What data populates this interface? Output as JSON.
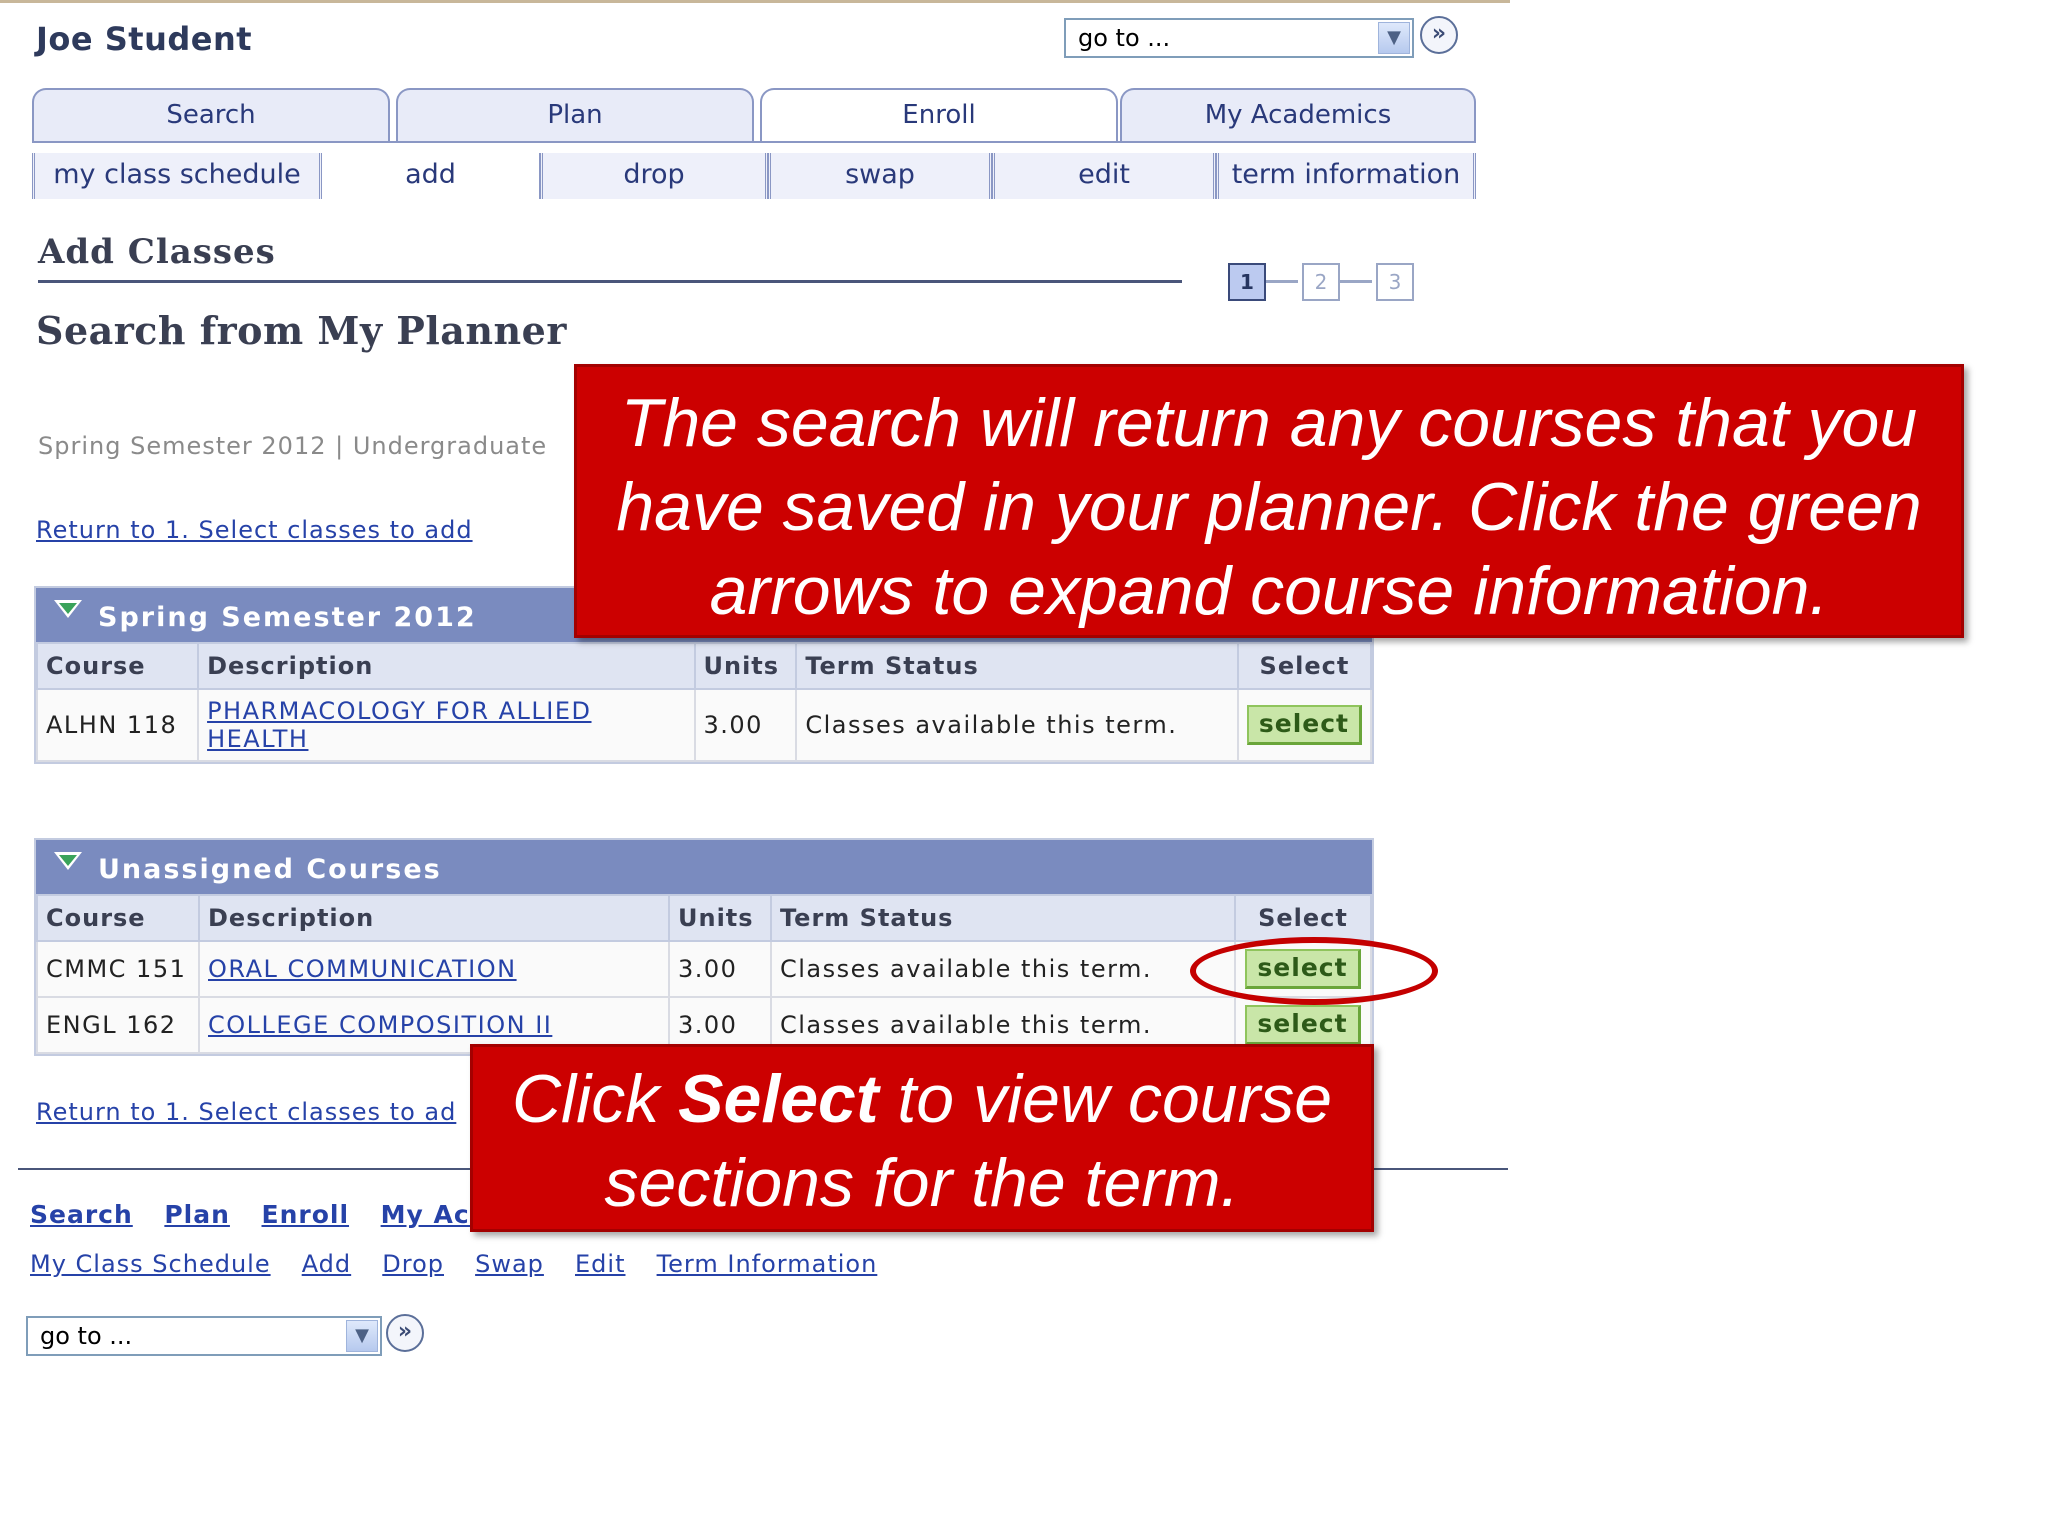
{
  "user": {
    "name": "Joe Student"
  },
  "goto": {
    "label": "go to ..."
  },
  "tabs": [
    {
      "label": "Search"
    },
    {
      "label": "Plan"
    },
    {
      "label": "Enroll"
    },
    {
      "label": "My Academics"
    }
  ],
  "subtabs": [
    {
      "label": "my class schedule"
    },
    {
      "label": "add"
    },
    {
      "label": "drop"
    },
    {
      "label": "swap"
    },
    {
      "label": "edit"
    },
    {
      "label": "term information"
    }
  ],
  "page": {
    "title": "Add Classes",
    "subtitle": "Search from My Planner",
    "term_line": "Spring Semester 2012 | Undergraduate",
    "return_link": "Return to 1. Select classes to add",
    "return_link_short": "Return to 1. Select classes to ad",
    "steps": [
      "1",
      "2",
      "3"
    ]
  },
  "grid_spring": {
    "title": "Spring Semester 2012",
    "headers": [
      "Course",
      "Description",
      "Units",
      "Term Status",
      "Select"
    ],
    "rows": [
      {
        "course": "ALHN 118",
        "description": "PHARMACOLOGY FOR ALLIED HEALTH",
        "units": "3.00",
        "status": "Classes available this term.",
        "select": "select"
      }
    ]
  },
  "grid_unassigned": {
    "title": "Unassigned Courses",
    "headers": [
      "Course",
      "Description",
      "Units",
      "Term Status",
      "Select"
    ],
    "rows": [
      {
        "course": "CMMC 151",
        "description": "ORAL COMMUNICATION",
        "units": "3.00",
        "status": "Classes available this term.",
        "select": "select"
      },
      {
        "course": "ENGL 162",
        "description": "COLLEGE COMPOSITION II",
        "units": "3.00",
        "status": "Classes available this term.",
        "select": "select"
      }
    ]
  },
  "callouts": {
    "top": "The search will return any courses that you have saved in your planner. Click the green arrows to expand course information.",
    "bottom_pre": "Click ",
    "bottom_bold": "Select",
    "bottom_post": " to view course sections for the term."
  },
  "footer": {
    "links1": [
      "Search",
      "Plan",
      "Enroll",
      "My Acade"
    ],
    "links2": [
      "My Class Schedule",
      "Add",
      "Drop",
      "Swap",
      "Edit",
      "Term Information"
    ]
  },
  "colors": {
    "callout_red": "#cc0000",
    "grid_header": "#7a8bbf",
    "select_green": "#c9e6a8"
  }
}
